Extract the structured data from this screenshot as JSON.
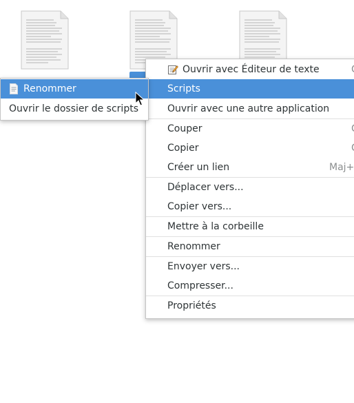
{
  "files": [
    {
      "name": "",
      "selected": false
    },
    {
      "name": "",
      "selected": true
    },
    {
      "name": "",
      "selected": false
    }
  ],
  "context_menu": {
    "items": [
      {
        "label": "Ouvrir avec Éditeur de texte",
        "accel": "C",
        "icon": "text-editor-icon"
      },
      {
        "label": "Scripts",
        "highlighted": true
      },
      {
        "label": "Ouvrir avec une autre application"
      },
      {
        "label": "Couper",
        "accel": "C"
      },
      {
        "label": "Copier",
        "accel": "C"
      },
      {
        "label": "Créer un lien",
        "accel": "Maj+C"
      },
      {
        "label": "Déplacer vers..."
      },
      {
        "label": "Copier vers..."
      },
      {
        "label": "Mettre à la corbeille"
      },
      {
        "label": "Renommer"
      },
      {
        "label": "Envoyer vers..."
      },
      {
        "label": "Compresser..."
      },
      {
        "label": "Propriétés"
      }
    ]
  },
  "scripts_submenu": {
    "items": [
      {
        "label": "Renommer",
        "highlighted": true,
        "icon": "script-file-icon"
      },
      {
        "label": "Ouvrir le dossier de scripts"
      }
    ]
  },
  "colors": {
    "highlight": "#4a90d9",
    "text": "#2e3436",
    "accel": "#8b8e8f"
  }
}
